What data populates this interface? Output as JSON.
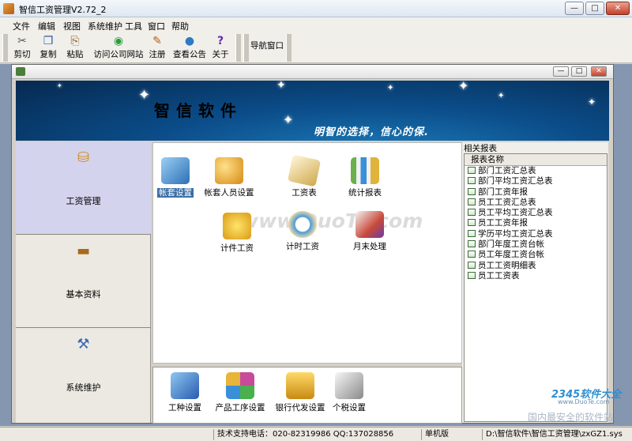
{
  "window": {
    "title": "智信工资管理V2.72_2",
    "min": "—",
    "max": "□",
    "close": "✕"
  },
  "menu": [
    "文件",
    "编辑",
    "视图",
    "系统维护",
    "工具",
    "窗口",
    "帮助"
  ],
  "toolbar": {
    "items": [
      {
        "label": "剪切",
        "icon": "scissors-icon",
        "glyph": "✂",
        "color": "#555"
      },
      {
        "label": "复制",
        "icon": "copy-icon",
        "glyph": "❐",
        "color": "#2a5aa8"
      },
      {
        "label": "粘贴",
        "icon": "paste-icon",
        "glyph": "⎘",
        "color": "#8a5a1a"
      },
      {
        "label": "访问公司网站",
        "icon": "website-icon",
        "glyph": "◉",
        "color": "#2e9a3a"
      },
      {
        "label": "注册",
        "icon": "register-icon",
        "glyph": "✎",
        "color": "#c05a10"
      },
      {
        "label": "查看公告",
        "icon": "globe-icon",
        "glyph": "●",
        "color": "#2c7bc2"
      },
      {
        "label": "关于",
        "icon": "help-icon",
        "glyph": "?",
        "color": "#6a2aa8"
      }
    ],
    "nav_window": "导航窗口"
  },
  "banner": {
    "title": "智信软件",
    "slogan": "明智的选择，信心的保."
  },
  "leftnav": [
    {
      "label": "工资管理",
      "icon": "salary-icon",
      "glyph": "⛁",
      "color": "#d28b12",
      "active": true
    },
    {
      "label": "基本资料",
      "icon": "book-icon",
      "glyph": "▬",
      "color": "#a86a1c",
      "active": false
    },
    {
      "label": "系统维护",
      "icon": "tools-icon",
      "glyph": "⚒",
      "color": "#3a6ab3",
      "active": false
    }
  ],
  "functions": [
    {
      "label": "帐套设置",
      "icon": "books-icon",
      "selected": true,
      "color": "#4b8fd0"
    },
    {
      "label": "帐套人员设置",
      "icon": "users-icon",
      "selected": false,
      "color": "#e0a12c"
    },
    {
      "label": "工资表",
      "icon": "payroll-icon",
      "selected": false,
      "color": "#d9b86a"
    },
    {
      "label": "统计报表",
      "icon": "chart-icon",
      "selected": false,
      "color": "#5a9a4a"
    },
    {
      "label": "计件工资",
      "icon": "piecework-icon",
      "selected": false,
      "color": "#e6c43a"
    },
    {
      "label": "计时工资",
      "icon": "clock-icon",
      "selected": false,
      "color": "#4a9ad8"
    },
    {
      "label": "月末处理",
      "icon": "month-end-icon",
      "selected": false,
      "color": "#c84a3a"
    }
  ],
  "watermark": "www.DuoTe.com",
  "bottom_functions": [
    {
      "label": "工种设置",
      "icon": "worker-icon",
      "color": "#3a7ac8"
    },
    {
      "label": "产品工序设置",
      "icon": "blocks-icon",
      "color": "#c84a9a"
    },
    {
      "label": "银行代发设置",
      "icon": "atm-icon",
      "color": "#e0a02a"
    },
    {
      "label": "个税设置",
      "icon": "calculator-icon",
      "color": "#8a8a8a"
    }
  ],
  "reports": {
    "header": "相关报表",
    "column": "报表名称",
    "rows": [
      "部门工资汇总表",
      "部门平均工资汇总表",
      "部门工资年报",
      "员工工资汇总表",
      "员工平均工资汇总表",
      "员工工资年报",
      "学历平均工资汇总表",
      "部门年度工资台帐",
      "员工年度工资台帐",
      "员工工资明细表",
      "员工工资表"
    ]
  },
  "status": {
    "support": "技术支持电话：020-82319986 QQ:137028856",
    "mode": "单机版",
    "path": "D:\\智信软件\\智信工资管理\\zxGZ1.sys"
  },
  "branding": {
    "logo": "2345软件大全",
    "url": "www.DuoTe.com",
    "tagline": "国内最安全的软件站"
  }
}
